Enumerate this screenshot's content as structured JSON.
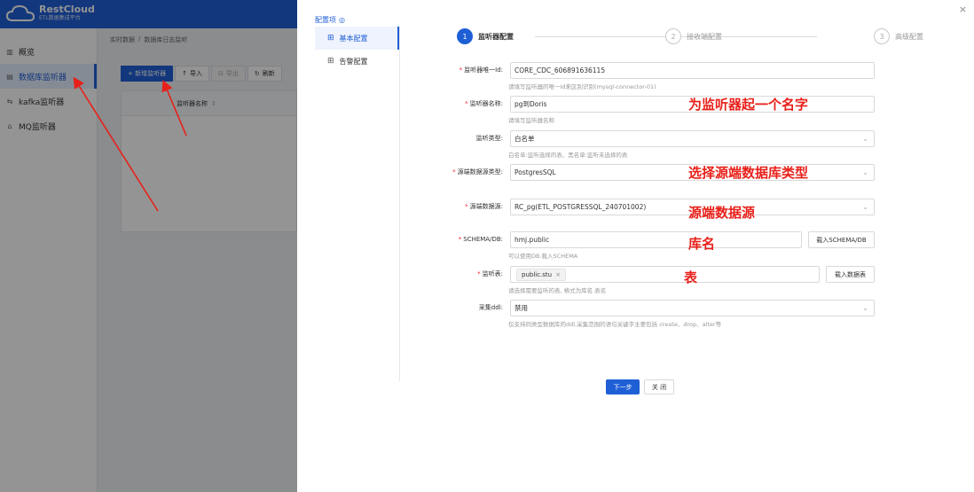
{
  "app": {
    "name": "RestCloud",
    "subtitle": "ETL数据集成平台"
  },
  "sidebar": {
    "items": [
      {
        "label": "概览",
        "icon": "bar-chart-icon"
      },
      {
        "label": "数据库监听器",
        "icon": "database-icon",
        "active": true
      },
      {
        "label": "kafka监听器",
        "icon": "kafka-icon"
      },
      {
        "label": "MQ监听器",
        "icon": "mq-icon"
      }
    ]
  },
  "breadcrumb": {
    "items": [
      "实时数据",
      "/",
      "数据库日志监听"
    ]
  },
  "toolbar": {
    "add": "+ 新增监听器",
    "import": "导入",
    "export": "导出",
    "refresh": "刷新"
  },
  "table": {
    "header_name": "监听器名称"
  },
  "drawer": {
    "nav_title": "配置项",
    "nav_items": [
      {
        "label": "基本配置",
        "active": true
      },
      {
        "label": "告警配置"
      }
    ],
    "steps": [
      {
        "num": "1",
        "label": "监听器配置"
      },
      {
        "num": "2",
        "label": "接收端配置"
      },
      {
        "num": "3",
        "label": "高级配置"
      }
    ],
    "form": {
      "uid": {
        "label": "监听器唯一Id:",
        "value": "CORE_CDC_606891636115",
        "hint": "请填写监听器的唯一Id来区别识别(mysql-connector-01)"
      },
      "name": {
        "label": "监听器名称:",
        "value": "pg到Doris",
        "hint": "请填写监听器名称"
      },
      "type": {
        "label": "监听类型:",
        "value": "白名单",
        "hint": "白名单:监听选择的表、黑名单:监听未选择的表"
      },
      "source_type": {
        "label": "源端数据源类型:",
        "value": "PostgresSQL"
      },
      "source": {
        "label": "源端数据源:",
        "value": "RC_pg(ETL_POSTGRESSQL_240701002)"
      },
      "schema": {
        "label": "SCHEMA/DB:",
        "value": "hmj.public",
        "button": "载入SCHEMA/DB",
        "hint": "可以使用DB.载入SCHEMA"
      },
      "tables": {
        "label": "监听表:",
        "tag": "public.stu",
        "button": "载入数据表",
        "hint": "请选择需要监听的表, 格式为库名.表名"
      },
      "ddl": {
        "label": "采集ddl:",
        "value": "禁用",
        "hint": "仅支持同类型数据库的ddl,采集范围的语句关键字主要包括 create、drop、alter等"
      }
    },
    "buttons": {
      "next": "下一步",
      "close": "关 闭"
    }
  },
  "annotations": {
    "name": "为监听器起一个名字",
    "source_type": "选择源端数据库类型",
    "source": "源端数据源",
    "schema": "库名",
    "table": "表"
  },
  "colors": {
    "primary": "#1f5fd6",
    "annotation": "#e8201a"
  }
}
